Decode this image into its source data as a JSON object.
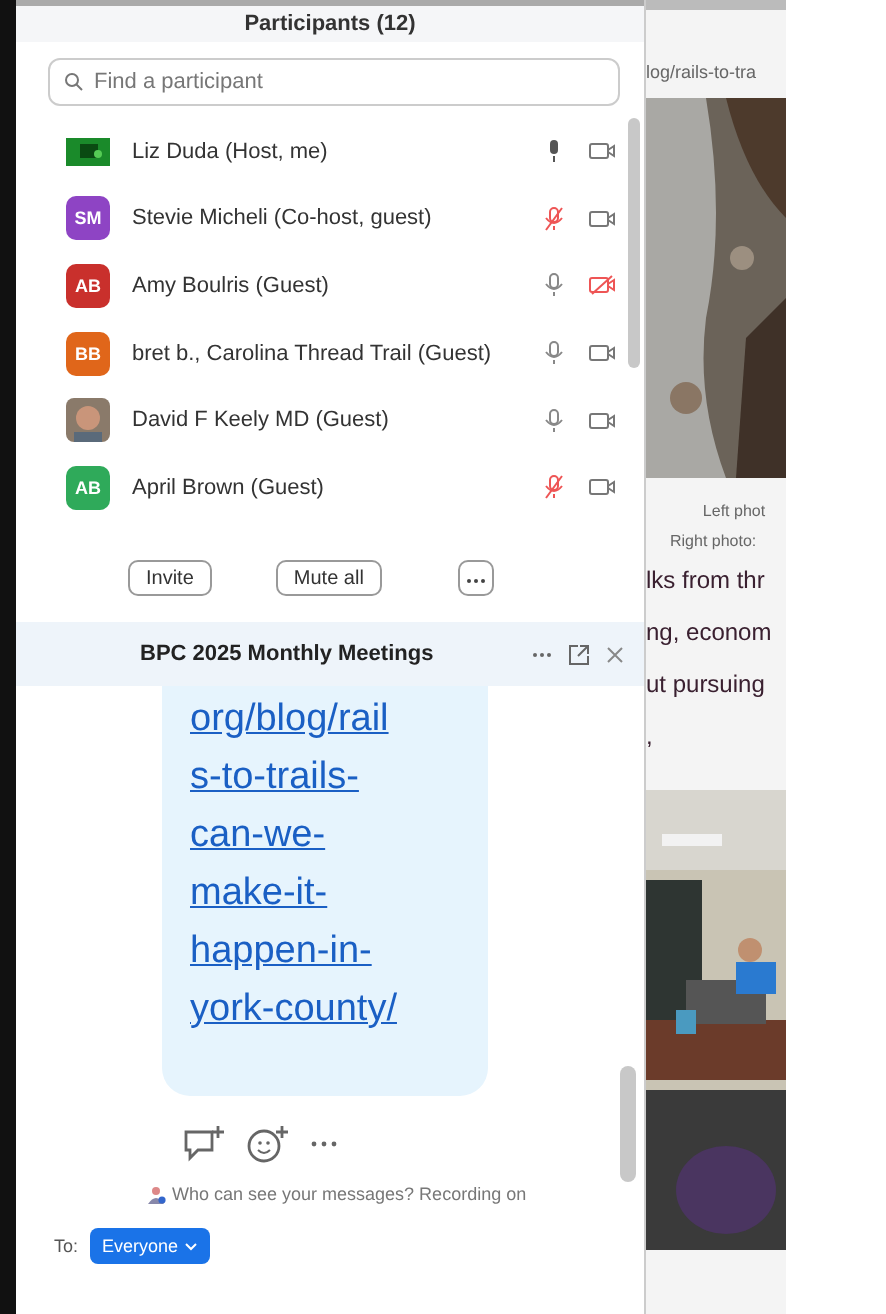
{
  "participants_panel": {
    "title": "Participants (12)",
    "search": {
      "placeholder": "Find a participant"
    },
    "participants": [
      {
        "name": "Liz Duda (Host, me)",
        "avatar": {
          "kind": "video"
        },
        "speaking": true,
        "muted": false,
        "video_blocked": false
      },
      {
        "name": "Stevie Micheli (Co-host, guest)",
        "avatar": {
          "kind": "initials",
          "initials": "SM",
          "color": "#8e44c4"
        },
        "speaking": false,
        "muted": true,
        "video_blocked": false
      },
      {
        "name": "Amy Boulris (Guest)",
        "avatar": {
          "kind": "initials",
          "initials": "AB",
          "color": "#c9302c"
        },
        "speaking": false,
        "muted": false,
        "video_blocked": true
      },
      {
        "name": "bret b., Carolina Thread Trail (Guest)",
        "avatar": {
          "kind": "initials",
          "initials": "BB",
          "color": "#e0661a"
        },
        "speaking": false,
        "muted": false,
        "video_blocked": false
      },
      {
        "name": "David F Keely MD (Guest)",
        "speaking": false,
        "muted": false,
        "video_blocked": false
      },
      {
        "name": "April Brown (Guest)",
        "avatar": {
          "kind": "initials",
          "initials": "AB",
          "color": "#2faa5a"
        },
        "speaking": false,
        "muted": true,
        "video_blocked": false
      }
    ],
    "buttons": [
      "Invite",
      "Mute all"
    ]
  },
  "chat_panel": {
    "title": "BPC 2025 Monthly Meetings",
    "message_link": [
      "org/blog/rail",
      "s-to-trails-",
      "can-we-",
      "make-it-",
      "happen-in-",
      "york-county/"
    ],
    "privacy_note": "Who can see your messages? Recording on",
    "to_label": "To:",
    "recipient": "Everyone"
  },
  "browser": {
    "url": "log/rails-to-tra",
    "captions": [
      "Left phot",
      "Right photo:"
    ],
    "paragraph_lines": [
      "lks from thr",
      "ng, econom",
      "ut pursuing",
      ","
    ]
  }
}
